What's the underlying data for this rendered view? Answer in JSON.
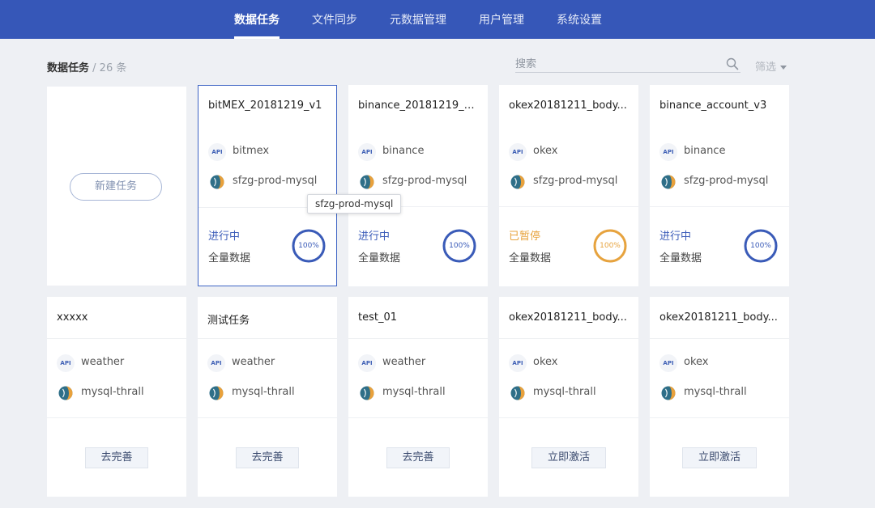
{
  "nav": {
    "tabs": [
      {
        "label": "数据任务",
        "active": true
      },
      {
        "label": "文件同步",
        "active": false
      },
      {
        "label": "元数据管理",
        "active": false
      },
      {
        "label": "用户管理",
        "active": false
      },
      {
        "label": "系统设置",
        "active": false
      }
    ]
  },
  "toolbar": {
    "title": "数据任务",
    "separator": " / ",
    "count": "26 条",
    "search_placeholder": "搜索",
    "filter_label": "筛选"
  },
  "new_task_label": "新建任务",
  "colors": {
    "nav_bg": "#3657b8",
    "running": "#3a5bb8",
    "paused": "#e7a33e"
  },
  "active_tasks": [
    {
      "title": "bitMEX_20181219_v1",
      "source": "bitmex",
      "target": "sfzg-prod-mysql",
      "status": "进行中",
      "status_type": "running",
      "mode": "全量数据",
      "progress": 100,
      "progress_label": "100%"
    },
    {
      "title": "binance_20181219_v...",
      "source": "binance",
      "target": "sfzg-prod-mysql",
      "status": "进行中",
      "status_type": "running",
      "mode": "全量数据",
      "progress": 100,
      "progress_label": "100%"
    },
    {
      "title": "okex20181211_body...",
      "source": "okex",
      "target": "sfzg-prod-mysql",
      "status": "已暂停",
      "status_type": "paused",
      "mode": "全量数据",
      "progress": 100,
      "progress_label": "100%"
    },
    {
      "title": "binance_account_v3",
      "source": "binance",
      "target": "sfzg-prod-mysql",
      "status": "进行中",
      "status_type": "running",
      "mode": "全量数据",
      "progress": 100,
      "progress_label": "100%"
    }
  ],
  "draft_tasks": [
    {
      "title": "xxxxx",
      "source": "weather",
      "target": "mysql-thrall",
      "action": "去完善"
    },
    {
      "title": "测试任务",
      "source": "weather",
      "target": "mysql-thrall",
      "action": "去完善"
    },
    {
      "title": "test_01",
      "source": "weather",
      "target": "mysql-thrall",
      "action": "去完善"
    },
    {
      "title": "okex20181211_body...",
      "source": "okex",
      "target": "mysql-thrall",
      "action": "立即激活"
    },
    {
      "title": "okex20181211_body...",
      "source": "okex",
      "target": "mysql-thrall",
      "action": "立即激活"
    }
  ],
  "api_badge_text": "API",
  "tooltip": "sfzg-prod-mysql"
}
